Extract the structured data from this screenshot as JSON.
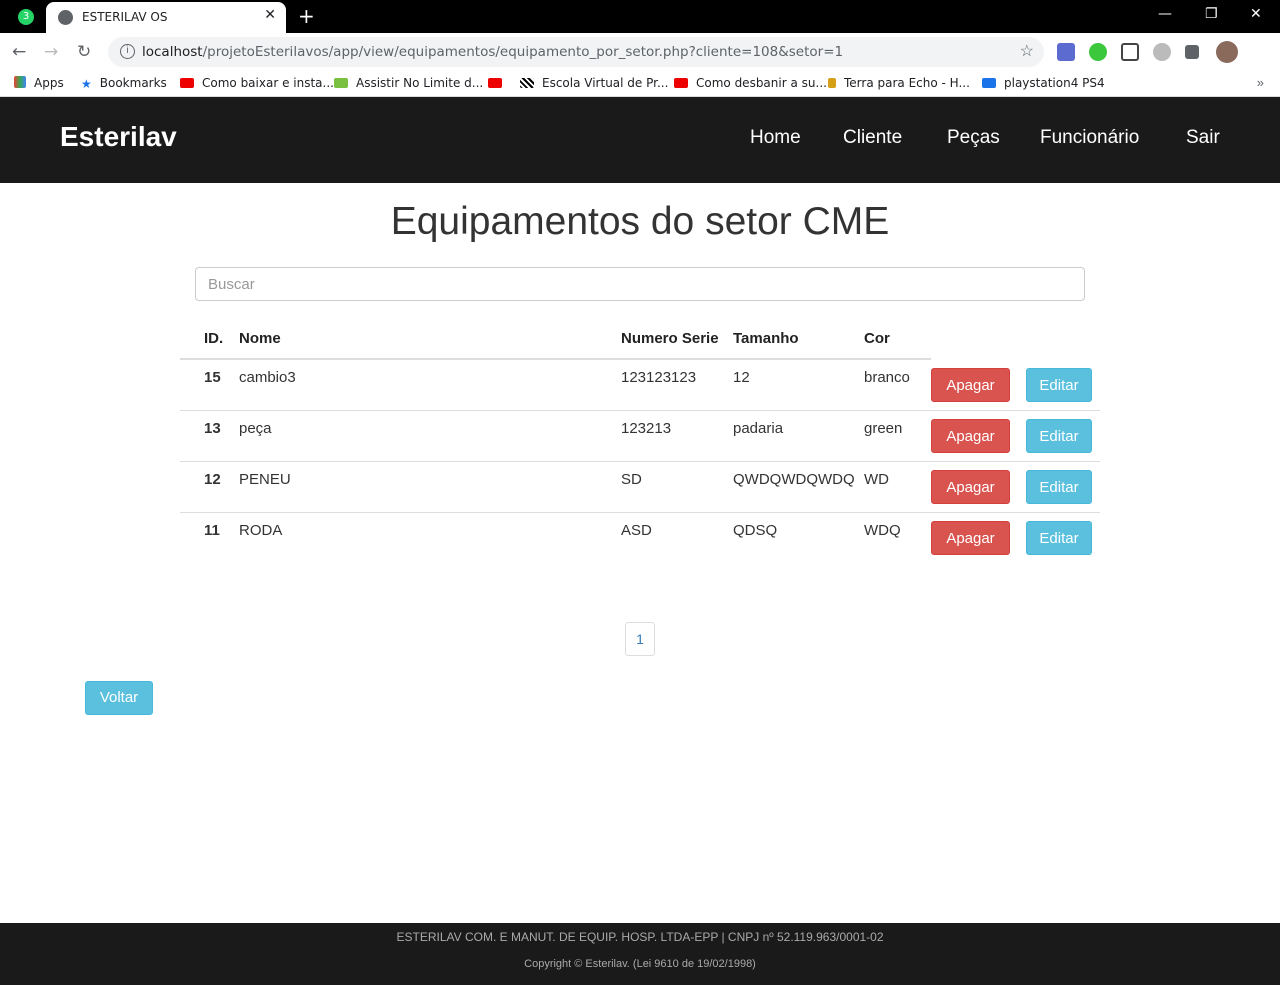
{
  "browser": {
    "pinned_badge": "3",
    "tab_title": "ESTERILAV OS",
    "tab_close": "✕",
    "new_tab": "+",
    "url_host": "localhost",
    "url_path": "/projetoEsterilavos/app/view/equipamentos/equipamento_por_setor.php?cliente=108&setor=1",
    "bookmarks": [
      "Apps",
      "Bookmarks",
      "Como baixar e insta...",
      "Assistir No Limite d...",
      "",
      "Escola Virtual de Pr...",
      "Como desbanir a su...",
      "Terra para Echo - H...",
      "playstation4 PS4"
    ],
    "bookmarks_more": "»"
  },
  "navbar": {
    "brand": "Esterilav",
    "links": [
      "Home",
      "Cliente",
      "Peças",
      "Funcionário",
      "Sair"
    ]
  },
  "page": {
    "title": "Equipamentos do setor CME",
    "search_placeholder": "Buscar"
  },
  "table": {
    "headers": {
      "id": "ID.",
      "nome": "Nome",
      "numero_serie": "Numero Serie",
      "tamanho": "Tamanho",
      "cor": "Cor"
    },
    "rows": [
      {
        "id": "15",
        "nome": "cambio3",
        "numero_serie": "123123123",
        "tamanho": "12",
        "cor": "branco"
      },
      {
        "id": "13",
        "nome": "peça",
        "numero_serie": "123213",
        "tamanho": "padaria",
        "cor": "green"
      },
      {
        "id": "12",
        "nome": "PENEU",
        "numero_serie": "SD",
        "tamanho": "QWDQWDQWDQ",
        "cor": "WD"
      },
      {
        "id": "11",
        "nome": "RODA",
        "numero_serie": "ASD",
        "tamanho": "QDSQ",
        "cor": "WDQ"
      }
    ],
    "delete_label": "Apagar",
    "edit_label": "Editar"
  },
  "pagination": {
    "current": "1"
  },
  "back_label": "Voltar",
  "footer": {
    "line1": "ESTERILAV COM. E MANUT. DE EQUIP. HOSP. LTDA-EPP | CNPJ nº 52.119.963/0001-02",
    "line2": "Copyright © Esterilav. (Lei 9610 de 19/02/1998)"
  },
  "colors": {
    "navbar": "#1a1a1a",
    "danger": "#d9534f",
    "info": "#5bc0de"
  }
}
